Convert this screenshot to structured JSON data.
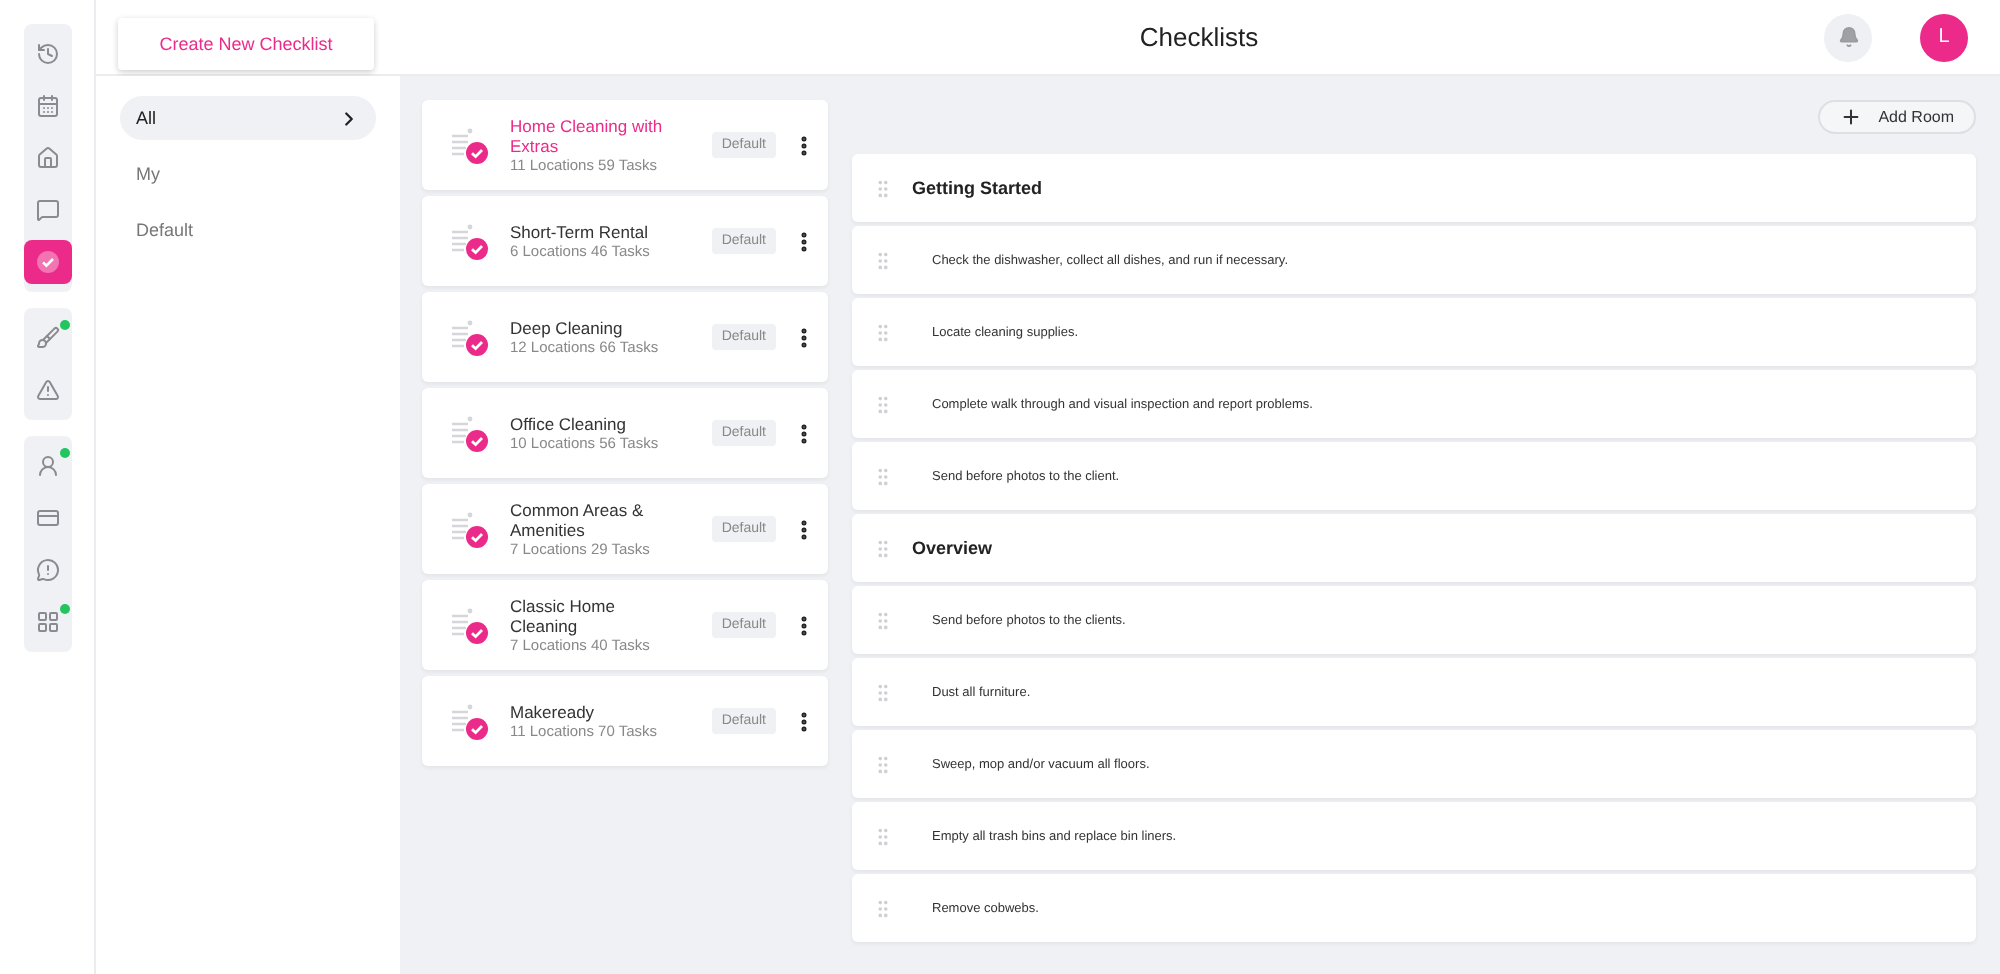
{
  "header": {
    "title": "Checklists",
    "create_button": "Create New Checklist",
    "avatar": "L"
  },
  "sidebar": {
    "groups": [
      {
        "items": [
          {
            "kind": "history",
            "selected": false,
            "notification": false
          },
          {
            "kind": "calendar",
            "selected": false,
            "notification": false
          },
          {
            "kind": "home",
            "selected": false,
            "notification": false
          },
          {
            "kind": "chat",
            "selected": false,
            "notification": false
          },
          {
            "kind": "checklist",
            "selected": true,
            "notification": false
          }
        ]
      },
      {
        "items": [
          {
            "kind": "broom",
            "selected": false,
            "notification": true
          },
          {
            "kind": "warning",
            "selected": false,
            "notification": false
          }
        ]
      },
      {
        "items": [
          {
            "kind": "user",
            "selected": false,
            "notification": true
          },
          {
            "kind": "card",
            "selected": false,
            "notification": false
          },
          {
            "kind": "alert",
            "selected": false,
            "notification": false
          },
          {
            "kind": "grid",
            "selected": false,
            "notification": true
          }
        ]
      }
    ]
  },
  "filters": [
    {
      "label": "All",
      "selected": true
    },
    {
      "label": "My",
      "selected": false
    },
    {
      "label": "Default",
      "selected": false
    }
  ],
  "checklists": [
    {
      "title": "Home Cleaning with Extras",
      "meta": "11 Locations 59 Tasks",
      "tag": "Default",
      "selected": true
    },
    {
      "title": "Short-Term Rental",
      "meta": "6 Locations 46 Tasks",
      "tag": "Default",
      "selected": false
    },
    {
      "title": "Deep Cleaning",
      "meta": "12 Locations 66 Tasks",
      "tag": "Default",
      "selected": false
    },
    {
      "title": "Office Cleaning",
      "meta": "10 Locations 56 Tasks",
      "tag": "Default",
      "selected": false
    },
    {
      "title": "Common Areas & Amenities",
      "meta": "7 Locations 29 Tasks",
      "tag": "Default",
      "selected": false
    },
    {
      "title": "Classic Home Cleaning",
      "meta": "7 Locations 40 Tasks",
      "tag": "Default",
      "selected": false
    },
    {
      "title": "Makeready",
      "meta": "11 Locations 70 Tasks",
      "tag": "Default",
      "selected": false
    }
  ],
  "add_room_button": "Add Room",
  "rooms": [
    {
      "kind": "section",
      "text": "Getting Started"
    },
    {
      "kind": "task",
      "text": "Check the dishwasher, collect all dishes, and run if necessary."
    },
    {
      "kind": "task",
      "text": "Locate cleaning supplies."
    },
    {
      "kind": "task",
      "text": "Complete walk through and visual inspection and report problems."
    },
    {
      "kind": "task",
      "text": "Send before photos to the client."
    },
    {
      "kind": "section",
      "text": "Overview"
    },
    {
      "kind": "task",
      "text": "Send before photos to the clients."
    },
    {
      "kind": "task",
      "text": "Dust all furniture."
    },
    {
      "kind": "task",
      "text": "Sweep, mop and/or vacuum all floors."
    },
    {
      "kind": "task",
      "text": "Empty all trash bins and replace bin liners."
    },
    {
      "kind": "task",
      "text": "Remove cobwebs."
    }
  ]
}
